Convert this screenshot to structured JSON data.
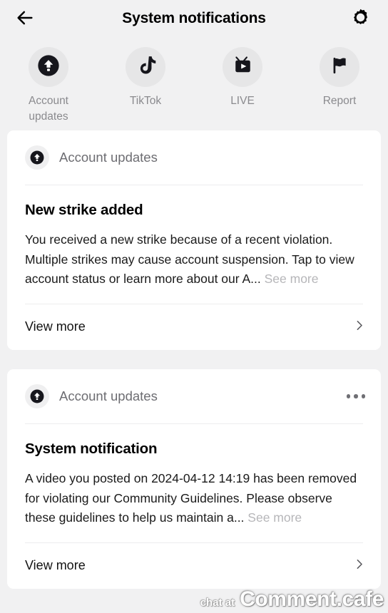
{
  "header": {
    "title": "System notifications",
    "back_icon": "arrow-left-icon",
    "settings_icon": "gear-icon"
  },
  "categories": [
    {
      "label": "Account updates",
      "icon": "account-updates-arrow-up-circle-icon"
    },
    {
      "label": "TikTok",
      "icon": "tiktok-note-icon"
    },
    {
      "label": "LIVE",
      "icon": "live-tv-play-icon"
    },
    {
      "label": "Report",
      "icon": "report-flag-icon"
    }
  ],
  "notifications": [
    {
      "source": "Account updates",
      "source_icon": "account-updates-arrow-up-circle-icon",
      "has_more_options": false,
      "title": "New strike added",
      "body": "You received a new strike because of a recent violation. Multiple strikes may cause account suspension. Tap to view account status or learn more about our A...",
      "see_more_label": "See more",
      "footer_label": "View more",
      "footer_icon": "chevron-right-icon"
    },
    {
      "source": "Account updates",
      "source_icon": "account-updates-arrow-up-circle-icon",
      "has_more_options": true,
      "more_options_icon": "ellipsis-horizontal-icon",
      "title": "System notification",
      "body": "A video you posted on 2024-04-12 14:19 has been removed for violating our Community Guidelines. Please observe these guidelines to help us maintain a...",
      "see_more_label": "See more",
      "footer_label": "View more",
      "footer_icon": "chevron-right-icon"
    }
  ],
  "watermark": {
    "prefix": "chat at",
    "brand": "Comment.cafe"
  },
  "colors": {
    "background": "#f1f1f2",
    "card": "#ffffff",
    "muted_text": "#6d6d72",
    "see_more": "#b6b6b9",
    "icon_dark": "#16161c"
  }
}
